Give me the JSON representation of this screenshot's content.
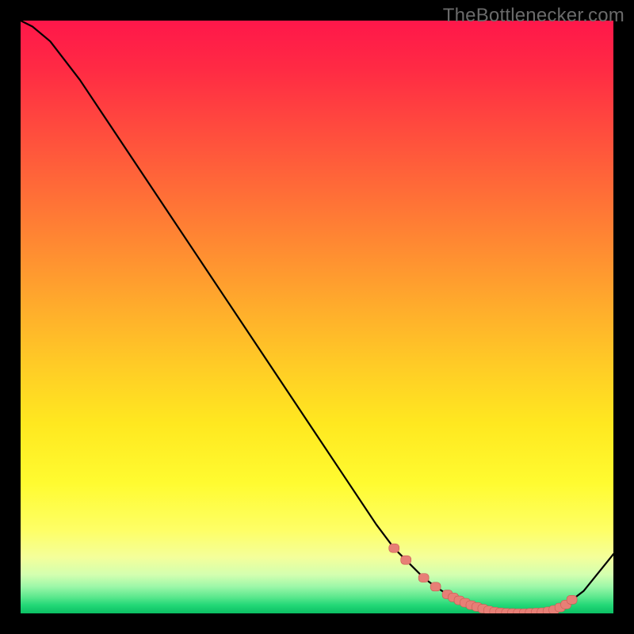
{
  "watermark": "TheBottlenecker.com",
  "chart_data": {
    "type": "line",
    "title": "",
    "xlabel": "",
    "ylabel": "",
    "xlim": [
      0,
      100
    ],
    "ylim": [
      0,
      100
    ],
    "x": [
      0,
      2,
      5,
      10,
      15,
      20,
      25,
      30,
      35,
      40,
      45,
      50,
      55,
      60,
      63,
      65,
      68,
      70,
      72,
      75,
      78,
      80,
      82,
      85,
      88,
      90,
      92,
      95,
      100
    ],
    "values": [
      100,
      99,
      96.5,
      90,
      82.5,
      75,
      67.5,
      60,
      52.5,
      45,
      37.5,
      30,
      22.5,
      15,
      11,
      9,
      6,
      4.5,
      3.2,
      1.8,
      0.8,
      0.3,
      0.1,
      0.05,
      0.2,
      0.6,
      1.5,
      3.8,
      10
    ],
    "markers": {
      "x": [
        63,
        65,
        68,
        70,
        72,
        73,
        74,
        75,
        76,
        77,
        78,
        79,
        80,
        81,
        82,
        83,
        84,
        85,
        86,
        87,
        88,
        89,
        90,
        91,
        92,
        93
      ],
      "y": [
        11,
        9,
        6,
        4.5,
        3.2,
        2.7,
        2.2,
        1.8,
        1.4,
        1.1,
        0.8,
        0.5,
        0.3,
        0.18,
        0.1,
        0.07,
        0.05,
        0.05,
        0.1,
        0.15,
        0.2,
        0.35,
        0.6,
        1.0,
        1.5,
        2.3
      ]
    },
    "background_gradient": {
      "stops": [
        {
          "pos": 0.0,
          "color": "#ff174a"
        },
        {
          "pos": 0.08,
          "color": "#ff2a44"
        },
        {
          "pos": 0.18,
          "color": "#ff4a3e"
        },
        {
          "pos": 0.28,
          "color": "#ff6a38"
        },
        {
          "pos": 0.38,
          "color": "#ff8a32"
        },
        {
          "pos": 0.48,
          "color": "#ffab2c"
        },
        {
          "pos": 0.58,
          "color": "#ffcb26"
        },
        {
          "pos": 0.68,
          "color": "#ffe820"
        },
        {
          "pos": 0.78,
          "color": "#fffb30"
        },
        {
          "pos": 0.86,
          "color": "#feff66"
        },
        {
          "pos": 0.905,
          "color": "#f4ff9a"
        },
        {
          "pos": 0.935,
          "color": "#d3ffb0"
        },
        {
          "pos": 0.955,
          "color": "#9cf7a8"
        },
        {
          "pos": 0.972,
          "color": "#5de88e"
        },
        {
          "pos": 0.986,
          "color": "#23d877"
        },
        {
          "pos": 1.0,
          "color": "#0bbf63"
        }
      ]
    },
    "marker_style": {
      "shape": "rounded-rect",
      "fill": "#e77f76",
      "stroke": "#c85a52"
    },
    "line_style": {
      "stroke": "#000000",
      "width": 2.2
    }
  }
}
